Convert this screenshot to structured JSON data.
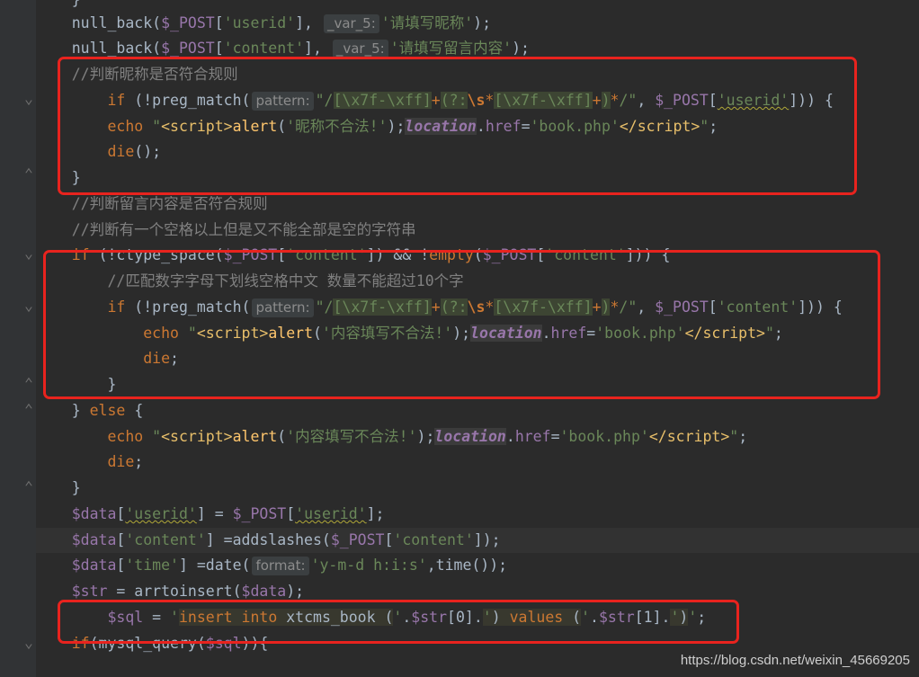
{
  "editor": {
    "hint_var5": "_var_5:",
    "hint_pattern": "pattern:",
    "hint_format": "format:",
    "comments": {
      "check_nick": "//判断昵称是否符合规则",
      "check_content": "//判断留言内容是否符合规则",
      "check_space": "//判断有一个空格以上但是又不能全部是空的字符串",
      "match_rule": "//匹配数字字母下划线空格中文 数量不能超过10个字"
    },
    "strings": {
      "fill_nick": "'请填写昵称'",
      "fill_content": "'请填写留言内容'",
      "alert_nick": "'昵称不合法!'",
      "alert_content": "'内容填写不合法!'",
      "book_php": "'book.php'",
      "date_format": "'y-m-d h:i:s'",
      "userid": "'userid'",
      "content": "'content'",
      "time": "'time'"
    }
  },
  "watermark": "https://blog.csdn.net/weixin_45669205",
  "colors": {
    "background": "#2b2b2b",
    "gutter": "#313335",
    "highlight_box": "#e8231e"
  }
}
